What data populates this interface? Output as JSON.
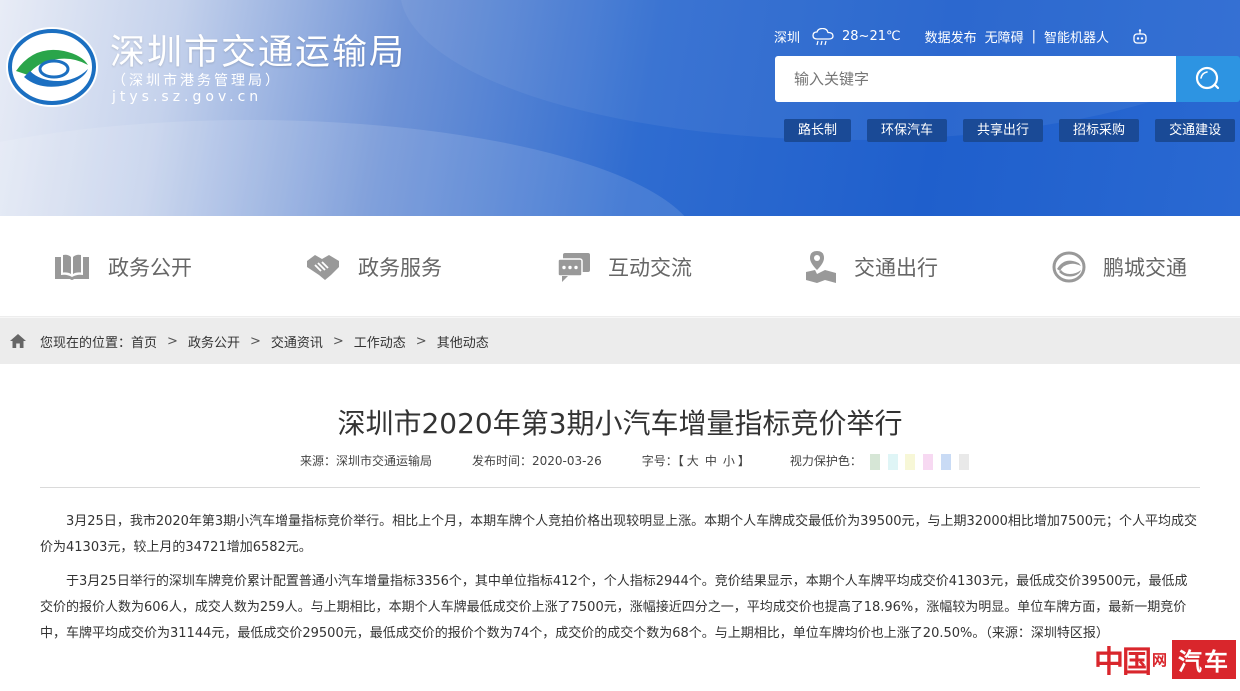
{
  "header": {
    "site_title": "深圳市交通运输局",
    "site_subtitle": "（深圳市港务管理局）",
    "site_url": "jtys.sz.gov.cn",
    "city": "深圳",
    "weather_icon": "cloud-rain-icon",
    "temperature": "28~21℃",
    "links": [
      "数据发布",
      "无障碍",
      "智能机器人"
    ],
    "separator": "|",
    "search_placeholder": "输入关键字",
    "quick_links": [
      "路长制",
      "环保汽车",
      "共享出行",
      "招标采购",
      "交通建设"
    ]
  },
  "mainnav": {
    "items": [
      {
        "label": "政务公开",
        "icon": "book-icon"
      },
      {
        "label": "政务服务",
        "icon": "handshake-icon"
      },
      {
        "label": "互动交流",
        "icon": "chat-icon"
      },
      {
        "label": "交通出行",
        "icon": "map-pin-icon"
      },
      {
        "label": "鹏城交通",
        "icon": "swirl-logo-icon"
      }
    ]
  },
  "breadcrumb": {
    "prefix": "您现在的位置：",
    "items": [
      "首页",
      "政务公开",
      "交通资讯",
      "工作动态",
      "其他动态"
    ],
    "arrow": ">"
  },
  "article": {
    "title": "深圳市2020年第3期小汽车增量指标竞价举行",
    "source": "来源：深圳市交通运输局",
    "publish_time": "发布时间：2020-03-26",
    "font_size_label": "字号：",
    "font_size_open": "【",
    "font_size_options": [
      "大",
      "中",
      "小"
    ],
    "font_size_close": "】",
    "eye_color_label": "视力保护色：",
    "eye_colors": [
      "#d6e6d6",
      "#dff5f6",
      "#f7f7d7",
      "#f7d9f2",
      "#c9dbf5",
      "#e9e9e9"
    ],
    "paragraph1": "3月25日，我市2020年第3期小汽车增量指标竞价举行。相比上个月，本期车牌个人竞拍价格出现较明显上涨。本期个人车牌成交最低价为39500元，与上期32000相比增加7500元；个人平均成交价为41303元，较上月的34721增加6582元。",
    "paragraph2": "于3月25日举行的深圳车牌竞价累计配置普通小汽车增量指标3356个，其中单位指标412个，个人指标2944个。竞价结果显示，本期个人车牌平均成交价41303元，最低成交价39500元，最低成交价的报价人数为606人，成交人数为259人。与上期相比，本期个人车牌最低成交价上涨了7500元，涨幅接近四分之一，平均成交价也提高了18.96%，涨幅较为明显。单位车牌方面，最新一期竞价中，车牌平均成交价为31144元，最低成交价29500元，最低成交价的报价个数为74个，成交价的成交个数为68个。与上期相比，单位车牌均价也上涨了20.50%。（来源：深圳特区报）"
  },
  "watermark": {
    "china": "中国",
    "net": "网",
    "car": "汽车"
  }
}
